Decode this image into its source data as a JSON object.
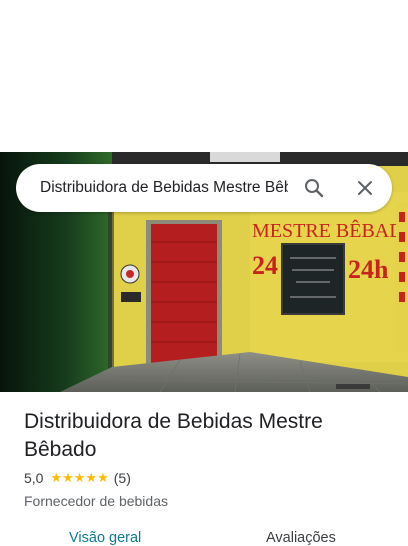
{
  "search": {
    "query": "Distribuidora de Bebidas Mestre Bêbado"
  },
  "photo_signs": {
    "name": "MESTRE BÊBADO",
    "hours_left": "24",
    "hours_right": "24h"
  },
  "place": {
    "title": "Distribuidora de Bebidas Mestre Bêbado",
    "rating": "5,0",
    "stars": "★★★★★",
    "review_count": "(5)",
    "category": "Fornecedor de bebidas"
  },
  "tabs": [
    {
      "label": "Visão geral"
    },
    {
      "label": "Avaliações"
    }
  ],
  "colors": {
    "star": "#fbbc04",
    "active_tab": "#0b7d8f",
    "shutter": "#b51e1e",
    "wall": "#e3d24a"
  }
}
